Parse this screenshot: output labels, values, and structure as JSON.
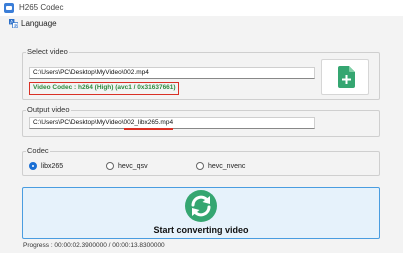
{
  "window": {
    "title": "H265 Codec",
    "app_icon": "video-icon"
  },
  "menubar": {
    "language_label": "Language",
    "language_icon": "translate-icon"
  },
  "select_video": {
    "group_label": "Select video",
    "path_value": "C:\\Users\\PC\\Desktop\\MyVideo\\002.mp4",
    "codec_info": "Video Codec : h264 (High) (avc1 / 0x31637661)",
    "add_button_icon": "add-file-icon"
  },
  "output_video": {
    "group_label": "Output video",
    "path_value": "C:\\Users\\PC\\Desktop\\MyVideo\\002_libx265.mp4"
  },
  "codec": {
    "group_label": "Codec",
    "options": [
      {
        "label": "libx265",
        "checked": true
      },
      {
        "label": "hevc_qsv",
        "checked": false
      },
      {
        "label": "hevc_nvenc",
        "checked": false
      }
    ]
  },
  "start": {
    "label": "Start converting video",
    "icon": "sync-icon"
  },
  "status": {
    "progress_text": "Progress : 00:00:02.3900000 / 00:00:13.8300000"
  },
  "colors": {
    "accent": "#1a6fd4",
    "highlight_red": "#d93025",
    "codec_green": "#2e8b3e",
    "icon_green": "#35a671",
    "button_bg": "#e6f2fb"
  }
}
